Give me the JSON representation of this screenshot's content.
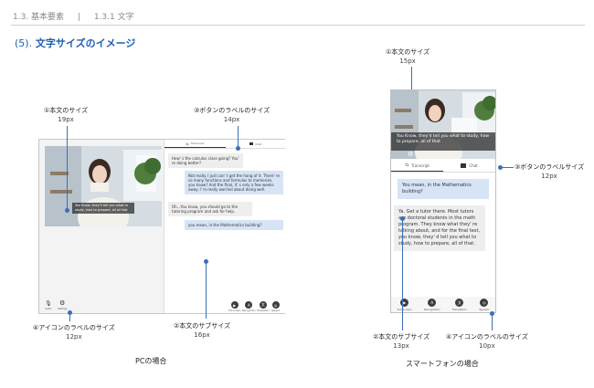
{
  "header": {
    "chapter": "1.3. 基本要素",
    "separator": "|",
    "section": "1.3.1 文字"
  },
  "section_title": {
    "number": "(5).",
    "text": "文字サイズのイメージ"
  },
  "pc": {
    "caption": "PCの場合",
    "tabs": [
      "Transcript",
      "Chat"
    ],
    "subtitle": "You Know, they'll tell you what to study, how to prepare, all of that",
    "messages": [
      "How' s the calculus class going? You' re doing better?",
      "Not really. I just can' t get the hang of it. There' re so many functions and formulas to memorize, you know? And the final, it' s only a few weeks away. I' m really worried about doing well.",
      "Oh...You know, you should go to the tutoring program and ask for help.",
      "you mean, in the Mathematics building?"
    ],
    "controls": [
      "Audio",
      "Settings",
      "Full screen",
      "Recognition",
      "Translation",
      "Speech"
    ],
    "annotations": [
      {
        "label": "①本文のサイズ",
        "size": "19px"
      },
      {
        "label": "③ボタンのラベルのサイズ",
        "size": "14px"
      },
      {
        "label": "④アイコンのラベルのサイズ",
        "size": "12px"
      },
      {
        "label": "②本文のサブサイズ",
        "size": "16px"
      }
    ]
  },
  "phone": {
    "caption": "スマートフォンの場合",
    "tabs": [
      "Transcript",
      "Chat"
    ],
    "subtitle": "You Know, they'd tell you what to study, how to prepare, all of that",
    "messages": [
      "You mean, in the Mathematics building?",
      "Ya. Get a tutor there. Most tutors are doctoral students in the math program. They know what they' re talking about, and for the final test, you know, they' d tell you what to study, how to prepare, all of that."
    ],
    "controls": [
      "Full screen",
      "Recognition",
      "Translation",
      "Speech"
    ],
    "annotations": [
      {
        "label": "①本文のサイズ",
        "size": "15px"
      },
      {
        "label": "③ボタンのラベルサイズ",
        "size": "12px"
      },
      {
        "label": "②本文のサブサイズ",
        "size": "13px"
      },
      {
        "label": "④アイコンのラベルのサイズ",
        "size": "10px"
      }
    ]
  },
  "colors": {
    "accent": "#1d5fb1",
    "marker": "#3a6fb8",
    "chat_blue": "#d6e4f6",
    "chat_gray": "#eeeeee"
  }
}
